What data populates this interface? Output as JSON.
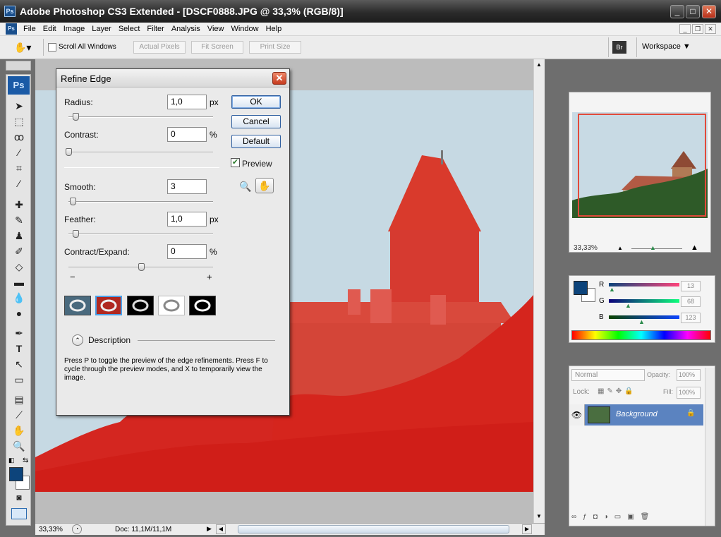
{
  "app": {
    "title": "Adobe Photoshop CS3 Extended - [DSCF0888.JPG @ 33,3% (RGB/8)]",
    "logo": "Ps"
  },
  "window_controls": {
    "minimize": "_",
    "maximize": "□",
    "close": "✕"
  },
  "menu": [
    "File",
    "Edit",
    "Image",
    "Layer",
    "Select",
    "Filter",
    "Analysis",
    "View",
    "Window",
    "Help"
  ],
  "options": {
    "scroll_all": "Scroll All Windows",
    "actual_pixels": "Actual Pixels",
    "fit_screen": "Fit Screen",
    "print_size": "Print Size",
    "workspace": "Workspace ▼",
    "bridge": "Br"
  },
  "tools": {
    "ps_label": "Ps"
  },
  "dialog": {
    "title": "Refine Edge",
    "radius_label": "Radius:",
    "radius_value": "1,0",
    "radius_unit": "px",
    "radius_slider": 0.05,
    "contrast_label": "Contrast:",
    "contrast_value": "0",
    "contrast_unit": "%",
    "contrast_slider": 0.0,
    "smooth_label": "Smooth:",
    "smooth_value": "3",
    "smooth_slider": 0.03,
    "feather_label": "Feather:",
    "feather_value": "1,0",
    "feather_unit": "px",
    "feather_slider": 0.05,
    "contract_label": "Contract/Expand:",
    "contract_value": "0",
    "contract_unit": "%",
    "contract_slider": 0.5,
    "minus": "−",
    "plus": "+",
    "ok": "OK",
    "cancel": "Cancel",
    "default": "Default",
    "preview_label": "Preview",
    "description_label": "Description",
    "description_text": "Press P to toggle the preview of the edge refinements. Press F to cycle through the preview modes, and X to temporarily view the image."
  },
  "navigator": {
    "zoom": "33,33%"
  },
  "color": {
    "r_label": "R",
    "r_value": "13",
    "g_label": "G",
    "g_value": "68",
    "b_label": "B",
    "b_value": "123",
    "foreground": "#0d447b"
  },
  "layers": {
    "blend_mode": "Normal",
    "opacity_label": "Opacity:",
    "opacity_value": "100%",
    "lock_label": "Lock:",
    "fill_label": "Fill:",
    "fill_value": "100%",
    "layer_name": "Background"
  },
  "status": {
    "zoom": "33,33%",
    "doc": "Doc: 11,1M/11,1M"
  }
}
